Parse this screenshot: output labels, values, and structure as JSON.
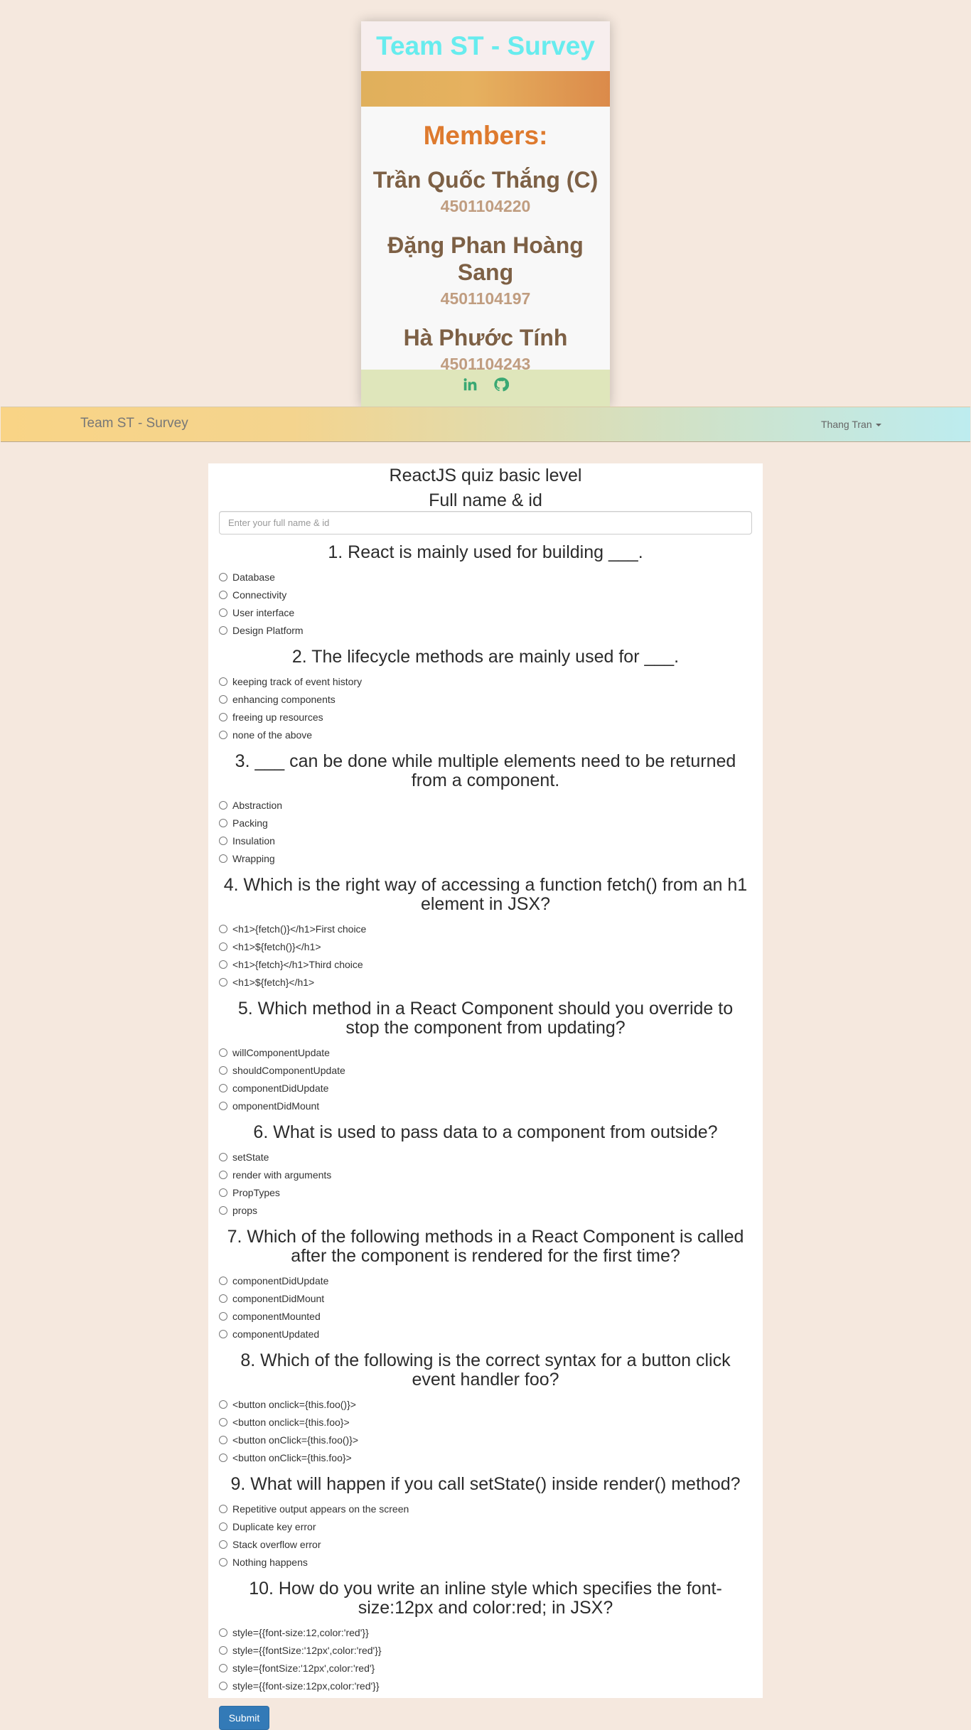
{
  "card": {
    "title": "Team ST - Survey",
    "members_title": "Members:",
    "members": [
      {
        "name": "Trần Quốc Thắng (C)",
        "id": "4501104220"
      },
      {
        "name": "Đặng Phan Hoàng Sang",
        "id": "4501104197"
      },
      {
        "name": "Hà Phước Tính",
        "id": "4501104243"
      }
    ],
    "footer_icons": [
      "linkedin-icon",
      "github-icon"
    ]
  },
  "navbar": {
    "brand": "Team ST - Survey",
    "user": "Thang Tran"
  },
  "quiz": {
    "title": "ReactJS quiz basic level",
    "name_label": "Full name & id",
    "name_placeholder": "Enter your full name & id",
    "questions": [
      {
        "title": "1. React is mainly used for building ___.",
        "options": [
          "Database",
          "Connectivity",
          "User interface",
          "Design Platform"
        ]
      },
      {
        "title": "2. The lifecycle methods are mainly used for ___.",
        "options": [
          "keeping track of event history",
          "enhancing components",
          "freeing up resources",
          "none of the above"
        ]
      },
      {
        "title": "3. ___ can be done while multiple elements need to be returned from a component.",
        "options": [
          "Abstraction",
          "Packing",
          "Insulation",
          "Wrapping"
        ]
      },
      {
        "title": "4. Which is the right way of accessing a function fetch() from an h1 element in JSX?",
        "options": [
          "<h1>{fetch()}</h1>First choice",
          "<h1>${fetch()}</h1>",
          "<h1>{fetch}</h1>Third choice",
          "<h1>${fetch}</h1>"
        ]
      },
      {
        "title": "5. Which method in a React Component should you override to stop the component from updating?",
        "options": [
          "willComponentUpdate",
          "shouldComponentUpdate",
          "componentDidUpdate",
          "omponentDidMount"
        ]
      },
      {
        "title": "6. What is used to pass data to a component from outside?",
        "options": [
          "setState",
          "render with arguments",
          "PropTypes",
          "props"
        ]
      },
      {
        "title": "7. Which of the following methods in a React Component is called after the component is rendered for the first time?",
        "options": [
          "componentDidUpdate",
          "componentDidMount",
          "componentMounted",
          "componentUpdated"
        ]
      },
      {
        "title": "8. Which of the following is the correct syntax for a button click event handler foo?",
        "options": [
          "<button onclick={this.foo()}>",
          "<button onclick={this.foo}>",
          "<button onClick={this.foo()}>",
          "<button onClick={this.foo}>"
        ]
      },
      {
        "title": "9. What will happen if you call setState() inside render() method?",
        "options": [
          "Repetitive output appears on the screen",
          "Duplicate key error",
          "Stack overflow error",
          "Nothing happens"
        ]
      },
      {
        "title": "10. How do you write an inline style which specifies the font-size:12px and color:red; in JSX?",
        "options": [
          "style={{font-size:12,color:'red'}}",
          "style={{fontSize:'12px',color:'red'}}",
          "style={fontSize:'12px',color:'red'}",
          "style={{font-size:12px,color:'red'}}"
        ]
      }
    ],
    "submit_label": "Submit"
  }
}
